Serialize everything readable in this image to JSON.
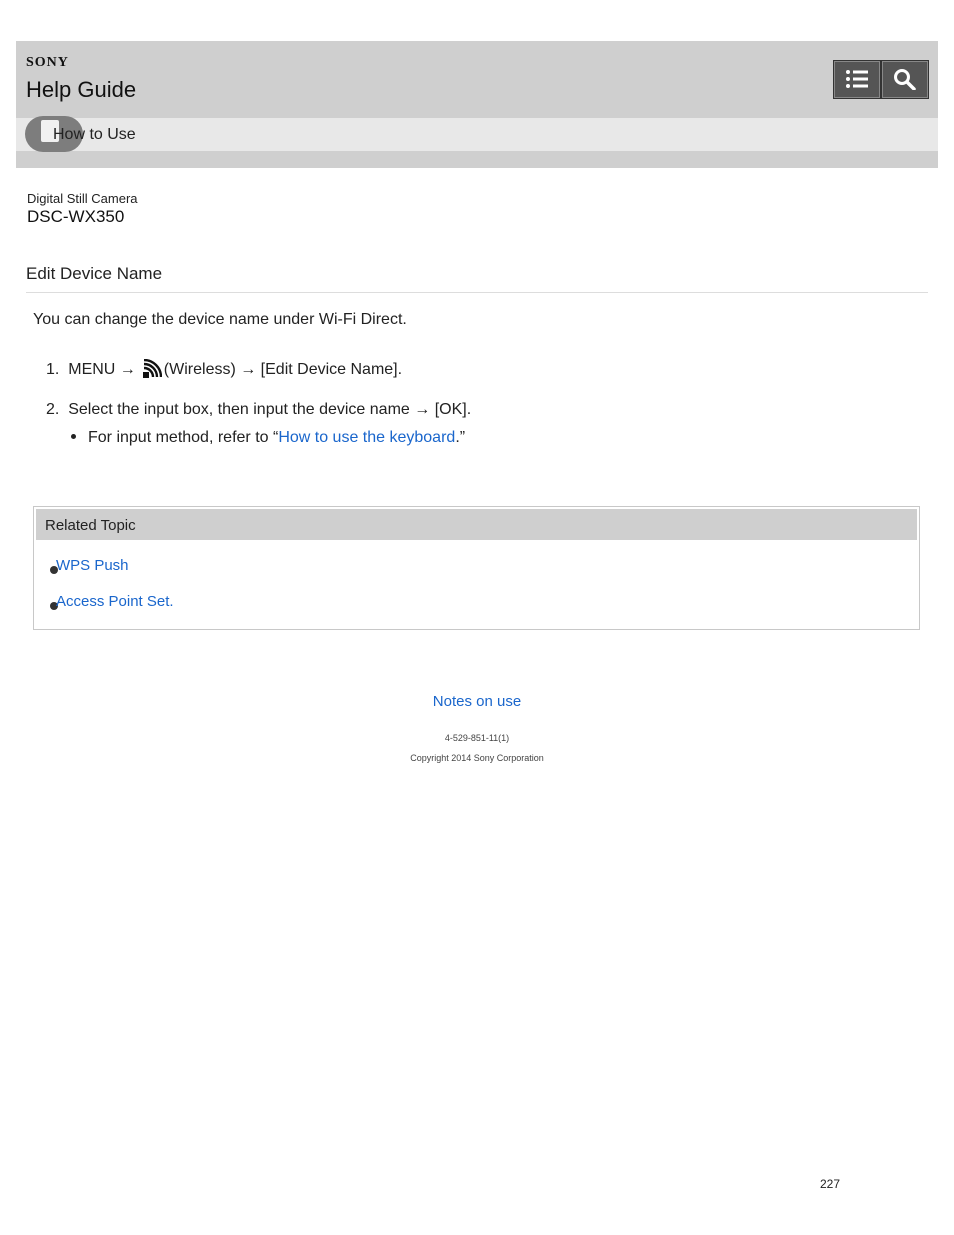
{
  "header": {
    "brand": "SONY",
    "title": "Help Guide",
    "breadcrumb": "How to Use"
  },
  "product": {
    "category": "Digital Still Camera",
    "model": "DSC-WX350"
  },
  "article": {
    "title": "Edit Device Name",
    "intro": "You can change the device name under Wi-Fi Direct.",
    "steps": [
      {
        "num": "1.",
        "before": "MENU →",
        "after": "(Wireless) → [Edit Device Name]."
      },
      {
        "num": "2.",
        "text": "Select the input box, then input the device name → [OK]."
      }
    ],
    "note": {
      "before": "For input method, refer to “",
      "link": "How to use the keyboard",
      "after": ".”"
    }
  },
  "related": {
    "title": "Related Topic",
    "items": [
      "WPS Push",
      "Access Point Set."
    ]
  },
  "footer": {
    "notes_link": "Notes on use",
    "code": "4-529-851-11(1)",
    "copyright": "Copyright 2014 Sony Corporation",
    "page_number": "227"
  },
  "icons": {
    "menu": "list-icon",
    "search": "magnifier-icon",
    "wireless": "wireless-icon",
    "breadcrumb": "document-icon"
  },
  "colors": {
    "link": "#1a66cc",
    "header_bg": "#cfcfcf",
    "button_bg": "#555555"
  }
}
